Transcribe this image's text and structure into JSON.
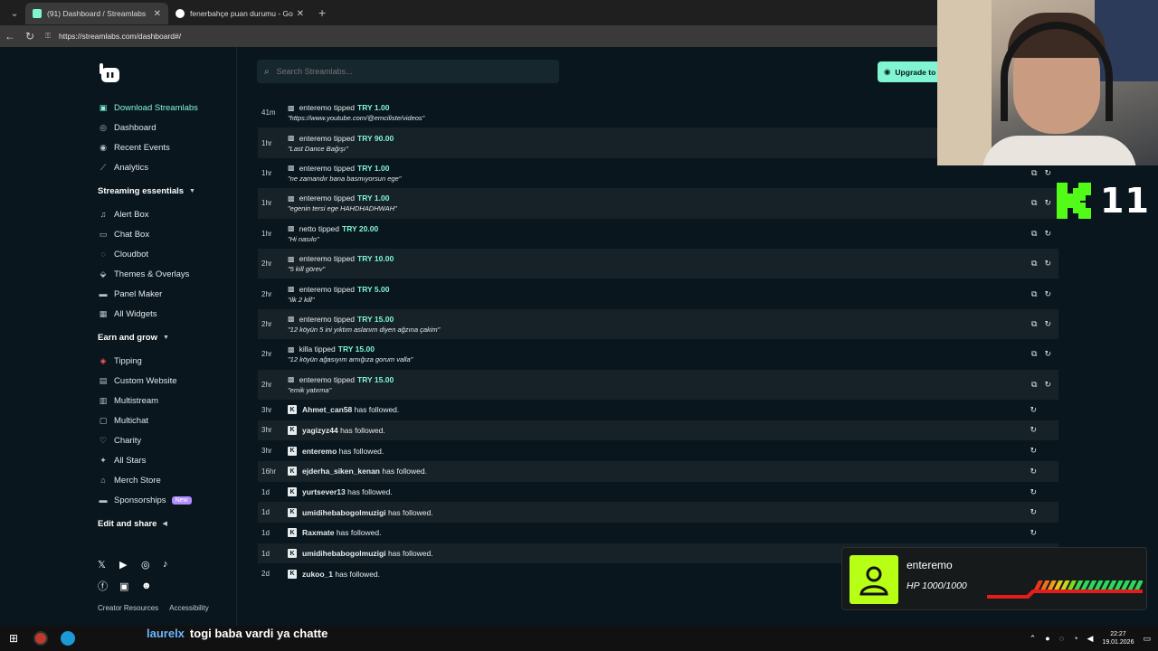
{
  "browser": {
    "tabs": [
      {
        "title": "(91) Dashboard / Streamlabs",
        "fav_color": "#80f5d2"
      },
      {
        "title": "fenerbahçe puan durumu - Googl",
        "fav_color": "#ffffff"
      }
    ],
    "url": "https://streamlabs.com/dashboard#/"
  },
  "sidebar": {
    "download": "Download Streamlabs",
    "top_items": [
      "Dashboard",
      "Recent Events",
      "Analytics"
    ],
    "section1": "Streaming essentials",
    "essentials": [
      "Alert Box",
      "Chat Box",
      "Cloudbot",
      "Themes & Overlays",
      "Panel Maker",
      "All Widgets"
    ],
    "section2": "Earn and grow",
    "earn": [
      "Tipping",
      "Custom Website",
      "Multistream",
      "Multichat",
      "Charity",
      "All Stars",
      "Merch Store",
      "Sponsorships"
    ],
    "new_badge": "New",
    "section3": "Edit and share",
    "footer": [
      "Creator Resources",
      "Accessibility"
    ],
    "social_icons": [
      "x-icon",
      "youtube-icon",
      "instagram-icon",
      "tiktok-icon",
      "facebook-icon",
      "linkedin-icon",
      "discord-icon"
    ]
  },
  "search": {
    "placeholder": "Search Streamlabs..."
  },
  "upgrade_label": "Upgrade to",
  "events": {
    "tips": [
      {
        "time": "41m",
        "user": "enteremo",
        "verb": "tipped",
        "amount": "TRY 1.00",
        "message": "\"https://www.youtube.com/@emciliste/videos\""
      },
      {
        "time": "1hr",
        "user": "enteremo",
        "verb": "tipped",
        "amount": "TRY 90.00",
        "message": "\"Last Dance Bağışı\""
      },
      {
        "time": "1hr",
        "user": "enteremo",
        "verb": "tipped",
        "amount": "TRY 1.00",
        "message": "\"ne zamandır bana basmıyorsun ege\""
      },
      {
        "time": "1hr",
        "user": "enteremo",
        "verb": "tipped",
        "amount": "TRY 1.00",
        "message": "\"egenin tersi ege HAHDHADHWAH\""
      },
      {
        "time": "1hr",
        "user": "netto",
        "verb": "tipped",
        "amount": "TRY 20.00",
        "message": "\"Hi nasılo\""
      },
      {
        "time": "2hr",
        "user": "enteremo",
        "verb": "tipped",
        "amount": "TRY 10.00",
        "message": "\"5 kill görev\""
      },
      {
        "time": "2hr",
        "user": "enteremo",
        "verb": "tipped",
        "amount": "TRY 5.00",
        "message": "\"ilk 2 kill\""
      },
      {
        "time": "2hr",
        "user": "enteremo",
        "verb": "tipped",
        "amount": "TRY 15.00",
        "message": "\"12 köyün 5 ini yıktım aslanım diyen ağzına çakim\""
      },
      {
        "time": "2hr",
        "user": "killa",
        "verb": "tipped",
        "amount": "TRY 15.00",
        "message": "\"12 köyün ağasıyım arnığıza gorum valla\""
      },
      {
        "time": "2hr",
        "user": "enteremo",
        "verb": "tipped",
        "amount": "TRY 15.00",
        "message": "\"emik yatırma\""
      }
    ],
    "follows": [
      {
        "time": "3hr",
        "user": "Ahmet_can58",
        "text": "has followed."
      },
      {
        "time": "3hr",
        "user": "yagizyz44",
        "text": "has followed."
      },
      {
        "time": "3hr",
        "user": "enteremo",
        "text": "has followed."
      },
      {
        "time": "16hr",
        "user": "ejderha_siken_kenan",
        "text": "has followed."
      },
      {
        "time": "1d",
        "user": "yurtsever13",
        "text": "has followed."
      },
      {
        "time": "1d",
        "user": "umidihebabogolmuzigi",
        "text": "has followed."
      },
      {
        "time": "1d",
        "user": "Raxmate",
        "text": "has followed."
      },
      {
        "time": "1d",
        "user": "umidihebabogolmuzigi",
        "text": "has followed."
      },
      {
        "time": "2d",
        "user": "zukoo_1",
        "text": "has followed."
      }
    ]
  },
  "overlay": {
    "kick_count": "11",
    "hp_user": "enteremo",
    "hp_text": "HP 1000/1000",
    "hp_fraction": 1.0
  },
  "chat": {
    "user": "laurelx",
    "message": "togi baba vardi ya chatte"
  },
  "taskbar": {
    "time": "22:27",
    "date": "19.01.2026"
  }
}
